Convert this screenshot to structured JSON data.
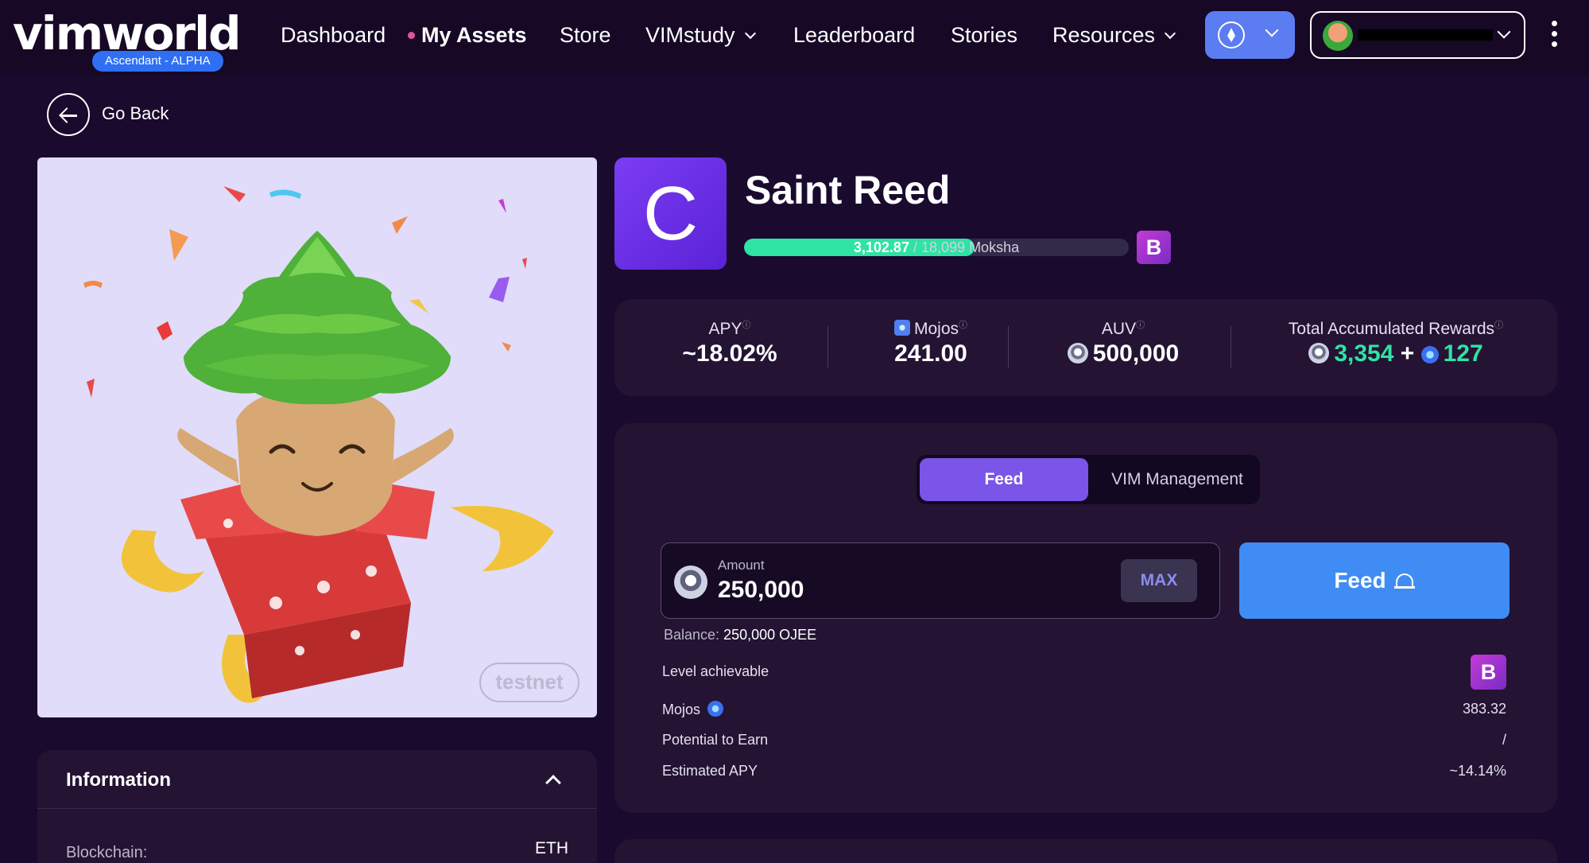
{
  "brand": {
    "logo_text": "vimworld",
    "badge": "Ascendant - ALPHA"
  },
  "nav": {
    "items": [
      "Dashboard",
      "My Assets",
      "Store",
      "VIMstudy",
      "Leaderboard",
      "Stories",
      "Resources"
    ],
    "active": "My Assets",
    "network": "ETH"
  },
  "back": {
    "label": "Go Back"
  },
  "asset": {
    "grade": "C",
    "name": "Saint Reed",
    "moksha_current": "3,102.87",
    "moksha_total": "/ 18,099",
    "moksha_unit": "Moksha",
    "moksha_progress": 0.6,
    "level": "B",
    "watermark": "testnet"
  },
  "stats": {
    "apy_label": "APY",
    "apy_value": "~18.02%",
    "mojos_label": "Mojos",
    "mojos_value": "241.00",
    "auv_label": "AUV",
    "auv_value": "500,000",
    "rewards_label": "Total Accumulated Rewards",
    "rewards_coin": "3,354",
    "rewards_plus": "+",
    "rewards_mojo": "127"
  },
  "feed": {
    "tab_feed": "Feed",
    "tab_vim": "VIM Management",
    "amount_label": "Amount",
    "amount_value": "250,000",
    "max_label": "MAX",
    "feed_button": "Feed",
    "balance_label": "Balance:",
    "balance_value": "250,000 OJEE",
    "rows": {
      "level_label": "Level achievable",
      "level_value": "B",
      "mojos_label": "Mojos",
      "mojos_value": "383.32",
      "potential_label": "Potential to Earn",
      "potential_value": "/",
      "apy_label": "Estimated APY",
      "apy_value": "~14.14%"
    }
  },
  "info": {
    "title": "Information",
    "blockchain_label": "Blockchain:",
    "blockchain_value": "ETH"
  },
  "colors": {
    "accent": "#7a55e8",
    "progress": "#2ee3a4",
    "feed_button": "#3f8cf4",
    "background": "#1a0a2e"
  }
}
